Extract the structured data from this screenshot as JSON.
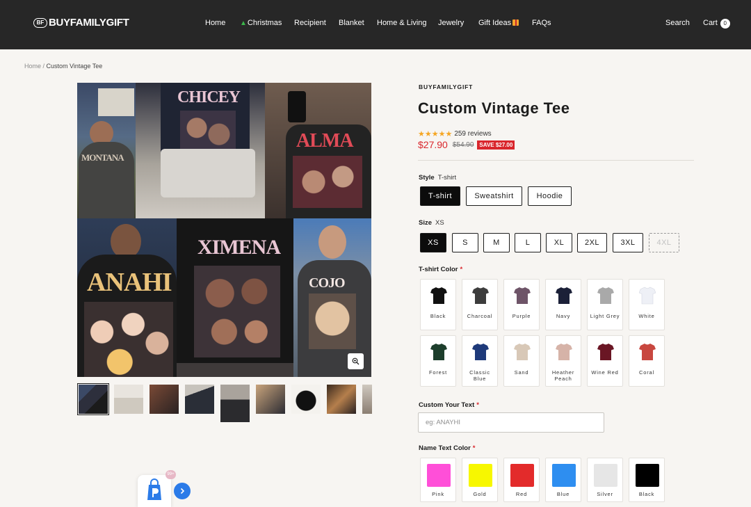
{
  "header": {
    "logo_mark": "BF",
    "logo_text": "BUYFAMILYGIFT",
    "nav": [
      {
        "label": "Home"
      },
      {
        "label": "Christmas"
      },
      {
        "label": "Recipient"
      },
      {
        "label": "Blanket"
      },
      {
        "label": "Home & Living"
      },
      {
        "label": "Jewelry"
      },
      {
        "label": "Gift Ideas"
      },
      {
        "label": "FAQs"
      }
    ],
    "search_label": "Search",
    "cart_label": "Cart",
    "cart_count": "0"
  },
  "breadcrumb": {
    "home": "Home",
    "separator": " / ",
    "current": "Custom Vintage Tee"
  },
  "gallery": {
    "panel_texts": [
      "MONTANA",
      "CHICEY",
      "ALMA",
      "ANAHI",
      "XIMENA",
      "COJO"
    ],
    "thumbnail_count": 9,
    "active_thumbnail": 1
  },
  "product": {
    "vendor": "BUYFAMILYGIFT",
    "title": "Custom Vintage Tee",
    "rating": 5,
    "reviews": "259 reviews",
    "price": "$27.90",
    "compare_price": "$54.90",
    "save_badge": "SAVE $27.00"
  },
  "style": {
    "label": "Style",
    "selected": "T-shirt",
    "options": [
      "T-shirt",
      "Sweatshirt",
      "Hoodie"
    ]
  },
  "size": {
    "label": "Size",
    "selected": "XS",
    "options": [
      "XS",
      "S",
      "M",
      "L",
      "XL",
      "2XL",
      "3XL",
      "4XL"
    ],
    "unavailable": [
      "4XL"
    ]
  },
  "shirt_color": {
    "label": "T-shirt Color",
    "required_mark": "*",
    "options": [
      {
        "name": "Black",
        "color": "#111111"
      },
      {
        "name": "Charcoal",
        "color": "#3d3d3d"
      },
      {
        "name": "Purple",
        "color": "#6e5468"
      },
      {
        "name": "Navy",
        "color": "#1b2038"
      },
      {
        "name": "Light Grey",
        "color": "#a9a9a9"
      },
      {
        "name": "White",
        "color": "#eef0f6"
      },
      {
        "name": "Forest",
        "color": "#1d3e2c"
      },
      {
        "name": "Classic Blue",
        "color": "#1e3a7a"
      },
      {
        "name": "Sand",
        "color": "#d8c8b7"
      },
      {
        "name": "Heather Peach",
        "color": "#d6b3a8"
      },
      {
        "name": "Wine Red",
        "color": "#6a1624"
      },
      {
        "name": "Coral",
        "color": "#c8473f"
      }
    ]
  },
  "custom_text": {
    "label": "Custom Your Text",
    "required_mark": "*",
    "placeholder": "eg: ANAYHI"
  },
  "name_text_color": {
    "label": "Name Text Color",
    "required_mark": "*",
    "options": [
      {
        "name": "Pink",
        "color": "#ff4fd8"
      },
      {
        "name": "Gold",
        "color": "#f7f700"
      },
      {
        "name": "Red",
        "color": "#e32b2b"
      },
      {
        "name": "Blue",
        "color": "#2e8ef0"
      },
      {
        "name": "Silver",
        "color": "#e6e6e6"
      },
      {
        "name": "Black",
        "color": "#000000"
      }
    ]
  },
  "widget": {
    "badge": "99+"
  }
}
